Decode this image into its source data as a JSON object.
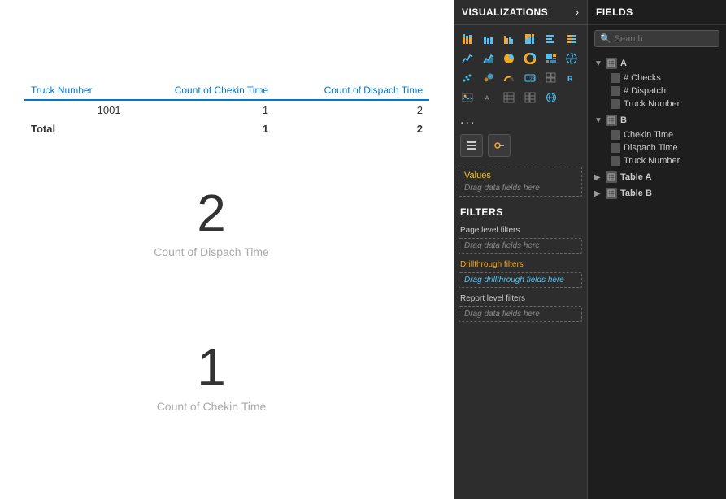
{
  "canvas": {
    "table": {
      "headers": [
        "Truck Number",
        "Count of Chekin Time",
        "Count of Dispach Time"
      ],
      "rows": [
        {
          "truck": "1001",
          "chekin": "1",
          "dispach": "2"
        }
      ],
      "total_row": {
        "label": "Total",
        "chekin": "1",
        "dispach": "2"
      }
    },
    "big_numbers": [
      {
        "value": "2",
        "label": "Count of Dispach Time"
      },
      {
        "value": "1",
        "label": "Count of Chekin Time"
      }
    ]
  },
  "viz_panel": {
    "title": "VISUALIZATIONS",
    "arrow": "›",
    "dots": "...",
    "dropzone": {
      "label": "Values",
      "hint": "Drag data fields here"
    }
  },
  "filters": {
    "title": "FILTERS",
    "items": [
      {
        "label": "Page level filters",
        "type": "normal"
      },
      {
        "hint": "Drag data fields here",
        "type": "drop"
      },
      {
        "label": "Drillthrough filters",
        "type": "orange"
      },
      {
        "hint": "Drag drillthrough fields here",
        "type": "drop-highlight"
      },
      {
        "label": "Report level filters",
        "type": "normal"
      },
      {
        "hint": "Drag data fields here",
        "type": "drop"
      }
    ]
  },
  "fields_panel": {
    "title": "FIELDS",
    "search_placeholder": "Search",
    "groups": [
      {
        "name": "A",
        "expanded": true,
        "fields": [
          "# Checks",
          "# Dispatch",
          "Truck Number"
        ]
      },
      {
        "name": "B",
        "expanded": true,
        "fields": [
          "Chekin Time",
          "Dispach Time",
          "Truck Number"
        ]
      },
      {
        "name": "Table A",
        "expanded": false,
        "fields": []
      },
      {
        "name": "Table B",
        "expanded": false,
        "fields": []
      }
    ]
  }
}
